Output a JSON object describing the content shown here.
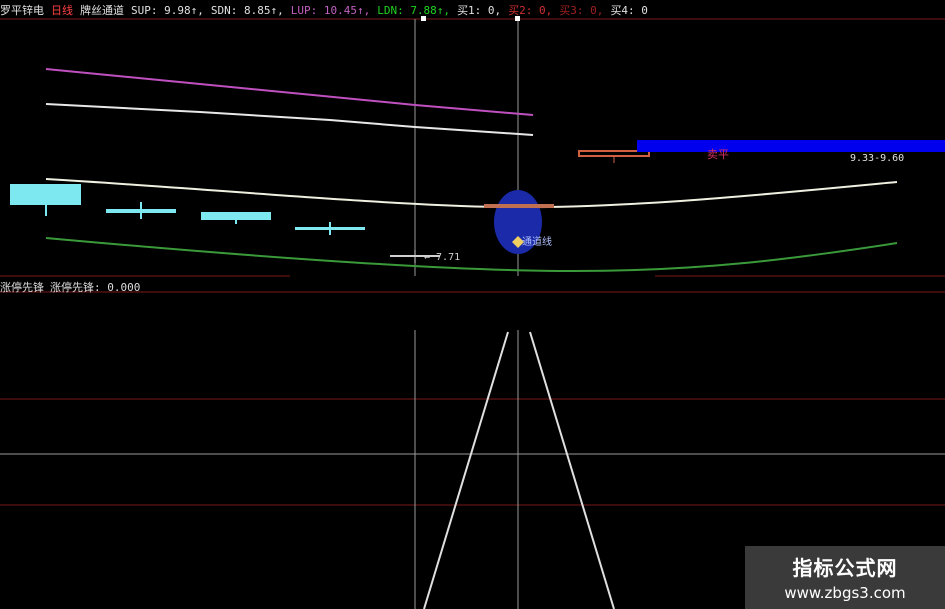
{
  "header": {
    "stock_name": "罗平锌电",
    "period": "日线",
    "indicator": "牌丝通道",
    "sup": "SUP: 9.98↑,",
    "sdn": "SDN: 8.85↑,",
    "lup": "LUP: 10.45↑,",
    "ldn": "LDN: 7.88↑,",
    "buy1": "买1: 0,",
    "buy2": "买2: 0,",
    "buy3": "买3: 0,",
    "buy4": "买4: 0"
  },
  "annotations": {
    "low_label": "← 7.71",
    "support_label": "通道线",
    "sell_label": "卖平",
    "range_label": "9.33-9.60"
  },
  "sub_panel": {
    "name": "涨停先锋",
    "value_text": "涨停先锋: 0.000"
  },
  "watermark": {
    "title": "指标公式网",
    "url": "www.zbgs3.com"
  },
  "colors": {
    "background": "#000000",
    "upper_channel": "#c050c0",
    "mid_upper_channel": "#e8e8e8",
    "mid_channel": "#f0f0e0",
    "lower_channel": "#3a9a3a",
    "bear_candle": "#7ee8f0",
    "bull_candle": "#d06040",
    "sell_bar": "#0000ee",
    "ellipse": "#1a2aa8",
    "grid": "#7a1a1a",
    "header_green": "#20d020",
    "header_purple": "#c060c0",
    "header_red": "#d03030"
  }
}
